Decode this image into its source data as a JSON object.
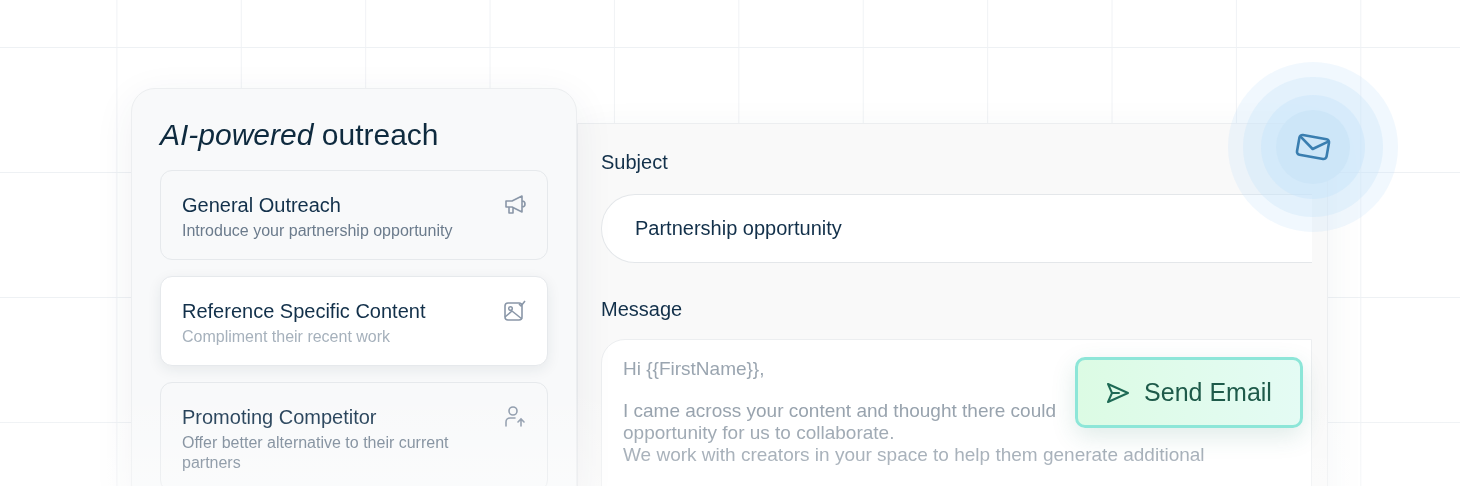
{
  "heading": "*AI-powered* outreach",
  "templates": [
    {
      "title": "General Outreach",
      "description": "Introduce your partnership opportunity",
      "selected": false
    },
    {
      "title": "Reference Specific Content",
      "description": "Compliment their recent work",
      "selected": true
    },
    {
      "title": "Promoting Competitor",
      "description": "Offer better alternative to their current partners",
      "selected": false
    }
  ],
  "subject": {
    "label": "Subject",
    "value": "Partnership opportunity"
  },
  "message": {
    "label": "Message",
    "lines": [
      "Hi {{FirstName}},",
      "I came across your content and thought there could",
      "opportunity for us to collaborate.",
      "We work with creators in your space to help them generate additional"
    ]
  },
  "send_button": {
    "label": "Send Email"
  }
}
